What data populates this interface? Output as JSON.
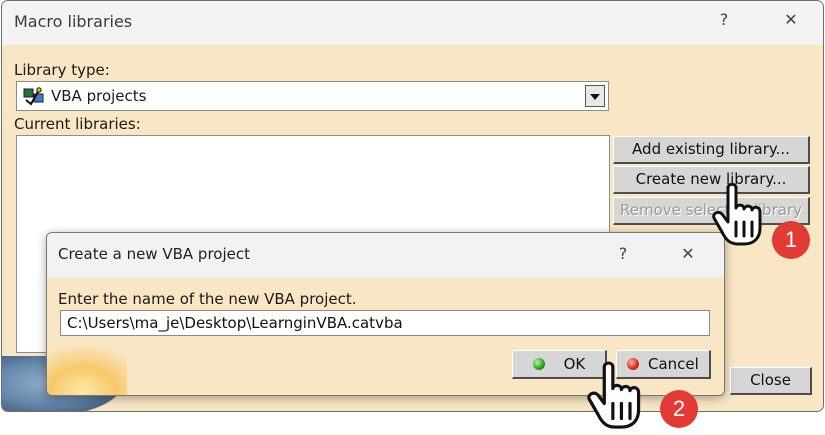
{
  "main_dialog": {
    "title": "Macro libraries",
    "help_label": "?",
    "close_label": "✕",
    "library_type_label": "Library type:",
    "library_type_value": "VBA projects",
    "current_libraries_label": "Current libraries:",
    "buttons": {
      "add_existing": "Add existing library...",
      "create_new": "Create new library...",
      "remove_selected": "Remove selected library",
      "close": "Close"
    }
  },
  "sub_dialog": {
    "title": "Create a new VBA project",
    "help_label": "?",
    "close_label": "✕",
    "prompt": "Enter the name of the new VBA project.",
    "input_value": "C:\\Users\\ma_je\\Desktop\\LearnginVBA.catvba",
    "ok_label": "OK",
    "cancel_label": "Cancel"
  },
  "annotations": {
    "step1": "1",
    "step2": "2"
  },
  "colors": {
    "dialog_bg": "#f9e6c4",
    "titlebar_bg": "#f3f3f3",
    "button_face": "#d6d6d6",
    "badge_red": "#e23b36"
  }
}
